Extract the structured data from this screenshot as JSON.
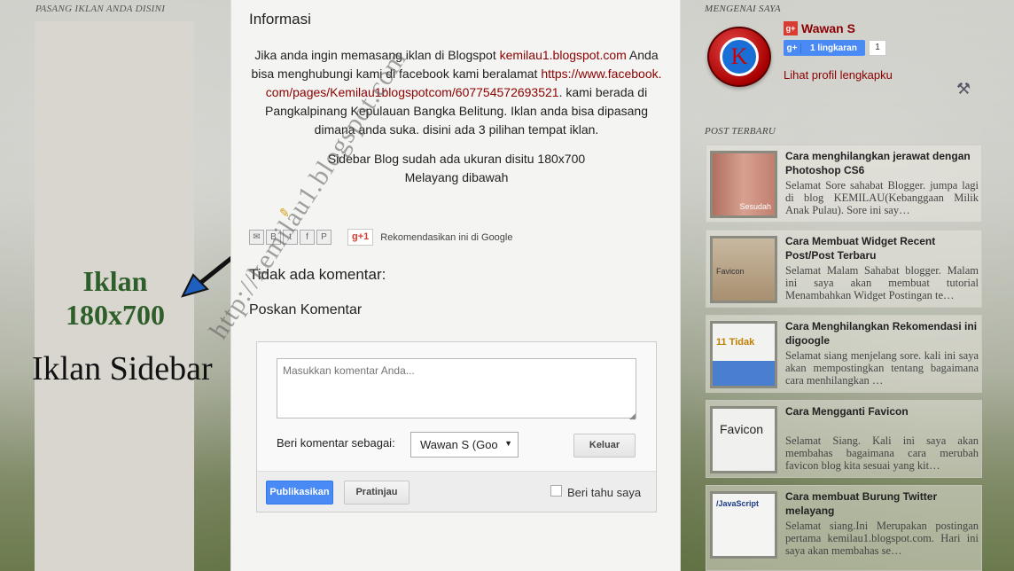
{
  "left_sidebar": {
    "heading": "PASANG IKLAN ANDA DISINI",
    "ad_line1": "Iklan",
    "ad_line2": "180x700",
    "ad_caption": "Iklan Sidebar"
  },
  "post": {
    "title": "Informasi",
    "body_p1_pre": "Jika anda ingin memasang iklan di Blogspot ",
    "body_link1": "kemilau1.blogspot.com",
    "body_p1_mid": " Anda bisa menghubungi kami di facebook kami beralamat ",
    "body_link2": "https://www.facebook.com/pages/Kemilau1blogspotcom/607754572693521",
    "body_p1_post": ". kami berada di Pangkalpinang Kepulauan Bangka Belitung. Iklan anda bisa dipasang dimana anda suka. disini ada 3 pilihan tempat iklan.",
    "body_p2_line1": "Sidebar Blog sudah ada ukuran disitu 180x700",
    "body_p2_line2": "Melayang dibawah",
    "gplus_label": "+1",
    "recommend_text": "Rekomendasikan ini di Google",
    "no_comments": "Tidak ada komentar:",
    "post_comment_title": "Poskan Komentar"
  },
  "comment_form": {
    "placeholder": "Masukkan komentar Anda...",
    "comment_as_label": "Beri komentar sebagai:",
    "selected_identity": "Wawan S (Goo",
    "logout_label": "Keluar",
    "publish_label": "Publikasikan",
    "preview_label": "Pratinjau",
    "notify_label": "Beri tahu saya"
  },
  "watermark": "http://kemilau1.blogspot.com",
  "right_sidebar": {
    "about_heading": "MENGENAI SAYA",
    "avatar_letter": "K",
    "profile_name": "Wawan S",
    "follow_label": "1 lingkaran",
    "follow_count": "1",
    "profile_link": "Lihat profil lengkapku",
    "recent_heading": "POST TERBARU",
    "posts": [
      {
        "title": "Cara menghilangkan jerawat dengan Photoshop CS6",
        "snippet": "Selamat Sore sahabat Blogger. jumpa lagi di blog KEMILAU(Kebanggaan Milik Anak Pulau). Sore ini say…",
        "thumb_text": "Sesudah"
      },
      {
        "title": "Cara Membuat Widget Recent Post/Post Terbaru",
        "snippet": "Selamat Malam Sahabat blogger. Malam ini saya akan membuat tutorial Menambahkan Widget Postingan te…",
        "thumb_text": "Favicon"
      },
      {
        "title": "Cara Menghilangkan Rekomendasi ini digoogle",
        "snippet": "Selamat siang menjelang sore. kali ini saya akan mempostingkan tentang bagaimana cara menhilangkan …",
        "thumb_text": "11 Tidak"
      },
      {
        "title": "Cara Mengganti Favicon",
        "snippet": "Selamat Siang. Kali ini saya akan membahas bagaimana cara merubah favicon blog kita sesuai yang kit…",
        "thumb_text": "Favicon"
      },
      {
        "title": "Cara membuat Burung Twitter melayang",
        "snippet": "Selamat siang.Ini Merupakan postingan pertama kemilau1.blogspot.com. Hari ini saya akan membahas se…",
        "thumb_text": "/JavaScript"
      }
    ]
  }
}
